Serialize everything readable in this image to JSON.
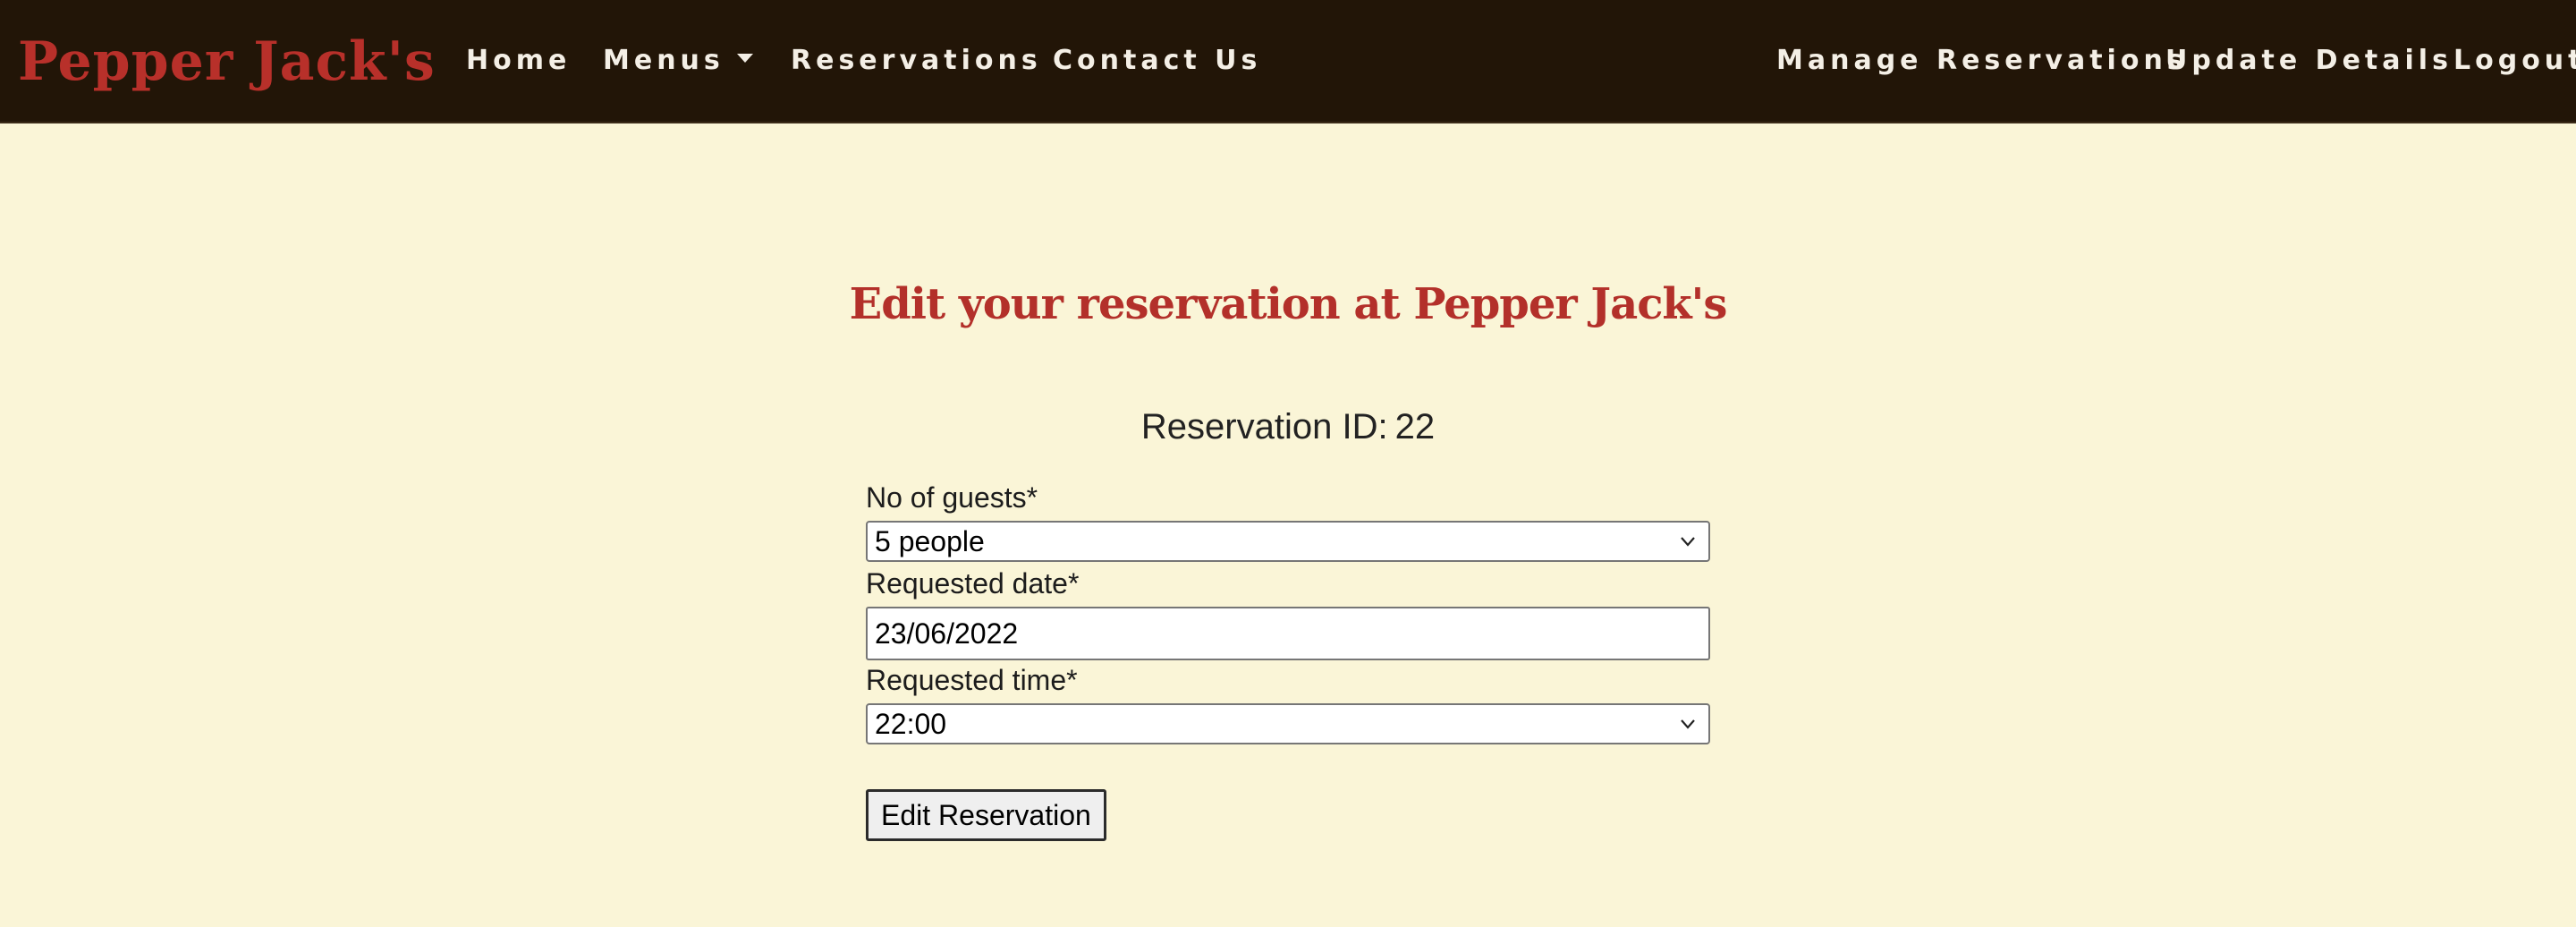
{
  "nav": {
    "brand": "Pepper Jack's",
    "left_links": [
      "Home",
      "Menus",
      "Reservations",
      "Contact Us"
    ],
    "right_links": [
      "Manage Reservations",
      "Update Details",
      "Logout"
    ]
  },
  "main": {
    "title": "Edit your reservation at Pepper Jack's",
    "reservation_id_label": "Reservation ID:",
    "reservation_id_value": "22",
    "fields": {
      "guests": {
        "label": "No of guests*",
        "value": "5 people"
      },
      "date": {
        "label": "Requested date*",
        "value": "23/06/2022"
      },
      "time": {
        "label": "Requested time*",
        "value": "22:00"
      }
    },
    "submit_label": "Edit Reservation"
  },
  "colors": {
    "navbar_bg": "#221507",
    "page_bg": "#faf5d7",
    "brand_red": "#b8302a",
    "nav_text": "#f4efe6"
  },
  "icons": {
    "menus_dropdown": "caret-down-icon",
    "select_arrow": "chevron-down-icon"
  }
}
